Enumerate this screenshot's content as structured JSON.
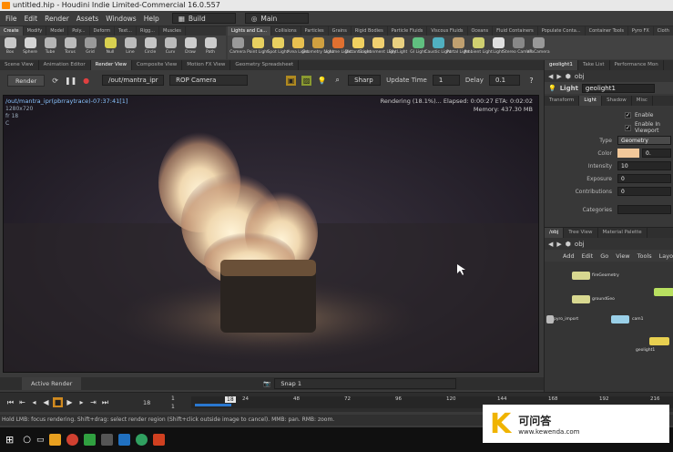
{
  "window": {
    "title": "untitled.hip - Houdini Indie Limited-Commercial 16.0.557"
  },
  "menu": {
    "items": [
      "File",
      "Edit",
      "Render",
      "Assets",
      "Windows",
      "Help"
    ],
    "desktop": "Build",
    "network": "Main"
  },
  "shelf_left": {
    "tabs": [
      "Create",
      "Modify",
      "Model",
      "Poly...",
      "Deform",
      "Text...",
      "Rigg...",
      "Muscles"
    ],
    "tools": [
      {
        "label": "Box",
        "color": "#c9c9c9"
      },
      {
        "label": "Sphere",
        "color": "#d5d5d5"
      },
      {
        "label": "Tube",
        "color": "#b5b5b5"
      },
      {
        "label": "Torus",
        "color": "#bbbbbb"
      },
      {
        "label": "Grid",
        "color": "#9a9a9a"
      },
      {
        "label": "Null",
        "color": "#d8d050"
      },
      {
        "label": "Line",
        "color": "#bbbbbb"
      },
      {
        "label": "Circle",
        "color": "#c5c5c5"
      },
      {
        "label": "Curv",
        "color": "#bbbbbb"
      },
      {
        "label": "Draw",
        "color": "#cccccc"
      },
      {
        "label": "Path",
        "color": "#cccccc"
      }
    ]
  },
  "shelf_right": {
    "tabs": [
      "Lights and Ca...",
      "Collisions",
      "Particles",
      "Grains",
      "Rigid Bodies",
      "Particle Fluids",
      "Viscous Fluids",
      "Oceans",
      "Fluid Containers",
      "Populate Conta...",
      "Container Tools",
      "Pyro FX",
      "Cloth"
    ],
    "tools": [
      {
        "label": "Camera",
        "color": "#9a9a9a"
      },
      {
        "label": "Point Light",
        "color": "#e8d060"
      },
      {
        "label": "Spot Light",
        "color": "#e8d060"
      },
      {
        "label": "Area Light",
        "color": "#e8c050"
      },
      {
        "label": "Geometry Light",
        "color": "#d0a040"
      },
      {
        "label": "Volume Light",
        "color": "#e07030"
      },
      {
        "label": "Distant Light",
        "color": "#f0d060"
      },
      {
        "label": "Environment Light",
        "color": "#f0d070"
      },
      {
        "label": "Sky Light",
        "color": "#e8d080"
      },
      {
        "label": "GI Light",
        "color": "#60c080"
      },
      {
        "label": "Caustic Light",
        "color": "#50b0c0"
      },
      {
        "label": "Portal Light",
        "color": "#c0a070"
      },
      {
        "label": "Ambient Light",
        "color": "#d0d070"
      },
      {
        "label": "Light",
        "color": "#e0e0e0"
      },
      {
        "label": "Stereo Camera",
        "color": "#888888"
      },
      {
        "label": "VR Camera",
        "color": "#999999"
      }
    ]
  },
  "pane_tabs_left": [
    "Scene View",
    "Animation Editor",
    "Render View",
    "Composite View",
    "Motion FX View",
    "Geometry Spreadsheet"
  ],
  "render_toolbar": {
    "render": "Render",
    "path": "/out/mantra_ipr",
    "camera": "ROP Camera",
    "snap": "Sharp",
    "update_label": "Update Time",
    "update_value": "1",
    "delay_label": "Delay",
    "delay_value": "0.1"
  },
  "viewport": {
    "path": "/out/mantra_ipr(pbrraytrace)-07:37:41[1]",
    "res": "1280x720",
    "frame": "fr 18",
    "chan": "C",
    "status": "Rendering (18.1%)...  Elapsed: 0:00:27  ETA: 0:02:02",
    "memory": "Memory:  437.30 MB"
  },
  "active_render": {
    "tab": "Active Render",
    "snap": "Snap 1"
  },
  "timeline": {
    "frame": "18",
    "start": "1",
    "end": "1",
    "ticks": [
      "24",
      "48",
      "72",
      "96",
      "120",
      "144",
      "168",
      "192",
      "216"
    ]
  },
  "status": "Hold LMB: focus rendering. Shift+drag: select render region (Shift+click outside image to cancel). MMB: pan. RMB: zoom.",
  "params": {
    "tabs": [
      "geolight1",
      "Take List",
      "Performance Mon"
    ],
    "path": "obj",
    "node_type": "Light",
    "node_name": "geolight1",
    "sub_tabs": [
      "Transform",
      "Light",
      "Shadow",
      "Misc"
    ],
    "enable": "Enable",
    "enable_view": "Enable In Viewport",
    "type_label": "Type",
    "type_value": "Geometry",
    "color_label": "Color",
    "color_value": "0.",
    "color": "#f2c89a",
    "intensity_label": "Intensity",
    "intensity_value": "10",
    "exposure_label": "Exposure",
    "exposure_value": "0",
    "contrib_label": "Contributions",
    "contrib_value": "0",
    "categories_label": "Categories"
  },
  "network": {
    "tabs": [
      "/obj",
      "Tree View",
      "Material Palette"
    ],
    "path": "obj",
    "menu": [
      "Add",
      "Edit",
      "Go",
      "View",
      "Tools",
      "Layout"
    ],
    "nodes": [
      {
        "label": "fireGeometry"
      },
      {
        "label": "groundGeo"
      },
      {
        "label": "pyro_import"
      },
      {
        "label": "cam1"
      },
      {
        "label": "geolight1"
      }
    ]
  },
  "watermark": {
    "logo": "K",
    "line1": "可问答",
    "line2": "www.kewenda.com"
  }
}
